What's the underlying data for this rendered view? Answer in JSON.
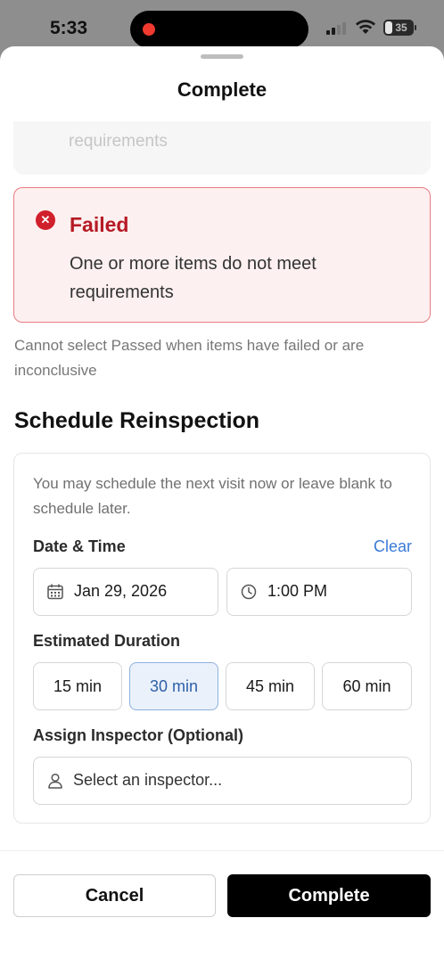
{
  "status_bar": {
    "time": "5:33",
    "battery": "35"
  },
  "sheet": {
    "title": "Complete"
  },
  "previous_option": {
    "text": "requirements"
  },
  "failed_option": {
    "icon": "x-circle-icon",
    "title": "Failed",
    "description": "One or more items do not meet requirements"
  },
  "helper_text": "Cannot select Passed when items have failed or are inconclusive",
  "reinspection": {
    "title": "Schedule Reinspection",
    "intro": "You may schedule the next visit now or leave blank to schedule later.",
    "date_time_label": "Date & Time",
    "clear_label": "Clear",
    "date_value": "Jan 29, 2026",
    "time_value": "1:00 PM",
    "duration_label": "Estimated Duration",
    "durations": [
      "15 min",
      "30 min",
      "45 min",
      "60 min"
    ],
    "selected_duration": "30 min",
    "inspector_label": "Assign Inspector (Optional)",
    "inspector_placeholder": "Select an inspector..."
  },
  "actions": {
    "cancel": "Cancel",
    "complete": "Complete"
  },
  "colors": {
    "danger": "#d0202c",
    "accent": "#3a7ad6",
    "primary_button": "#000000"
  }
}
